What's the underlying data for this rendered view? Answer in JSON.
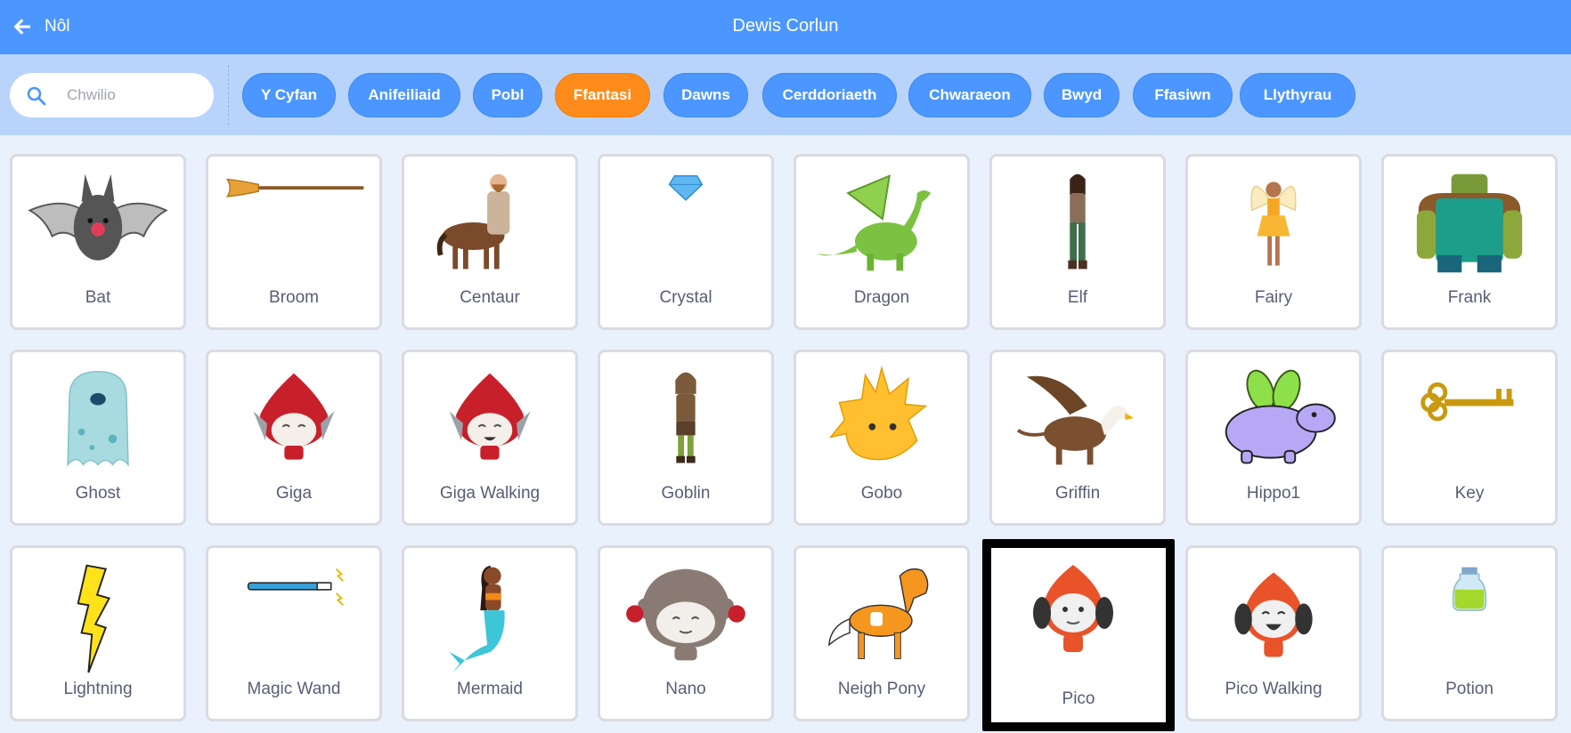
{
  "header": {
    "back_label": "Nôl",
    "title": "Dewis Corlun"
  },
  "search": {
    "placeholder": "Chwilio",
    "value": ""
  },
  "tags": [
    {
      "label": "Y Cyfan",
      "active": false
    },
    {
      "label": "Anifeiliaid",
      "active": false
    },
    {
      "label": "Pobl",
      "active": false
    },
    {
      "label": "Ffantasi",
      "active": true
    },
    {
      "label": "Dawns",
      "active": false
    },
    {
      "label": "Cerddoriaeth",
      "active": false
    },
    {
      "label": "Chwaraeon",
      "active": false
    },
    {
      "label": "Bwyd",
      "active": false
    },
    {
      "label": "Ffasiwn",
      "active": false
    },
    {
      "label": "Llythyrau",
      "active": false
    }
  ],
  "sprites": [
    {
      "name": "Bat",
      "icon": "bat-icon"
    },
    {
      "name": "Broom",
      "icon": "broom-icon"
    },
    {
      "name": "Centaur",
      "icon": "centaur-icon"
    },
    {
      "name": "Crystal",
      "icon": "crystal-icon"
    },
    {
      "name": "Dragon",
      "icon": "dragon-icon"
    },
    {
      "name": "Elf",
      "icon": "elf-icon"
    },
    {
      "name": "Fairy",
      "icon": "fairy-icon"
    },
    {
      "name": "Frank",
      "icon": "frank-icon"
    },
    {
      "name": "Ghost",
      "icon": "ghost-icon"
    },
    {
      "name": "Giga",
      "icon": "giga-icon"
    },
    {
      "name": "Giga Walking",
      "icon": "giga-walking-icon"
    },
    {
      "name": "Goblin",
      "icon": "goblin-icon"
    },
    {
      "name": "Gobo",
      "icon": "gobo-icon"
    },
    {
      "name": "Griffin",
      "icon": "griffin-icon"
    },
    {
      "name": "Hippo1",
      "icon": "hippo-icon"
    },
    {
      "name": "Key",
      "icon": "key-icon"
    },
    {
      "name": "Lightning",
      "icon": "lightning-icon"
    },
    {
      "name": "Magic Wand",
      "icon": "magic-wand-icon"
    },
    {
      "name": "Mermaid",
      "icon": "mermaid-icon"
    },
    {
      "name": "Nano",
      "icon": "nano-icon"
    },
    {
      "name": "Neigh Pony",
      "icon": "pony-icon"
    },
    {
      "name": "Pico",
      "icon": "pico-icon",
      "selected": true
    },
    {
      "name": "Pico Walking",
      "icon": "pico-walking-icon"
    },
    {
      "name": "Potion",
      "icon": "potion-icon"
    }
  ],
  "colors": {
    "header": "#4c97ff",
    "filterbar": "#b8d4fb",
    "active_tag": "#ff8c1a",
    "text": "#575e75"
  }
}
